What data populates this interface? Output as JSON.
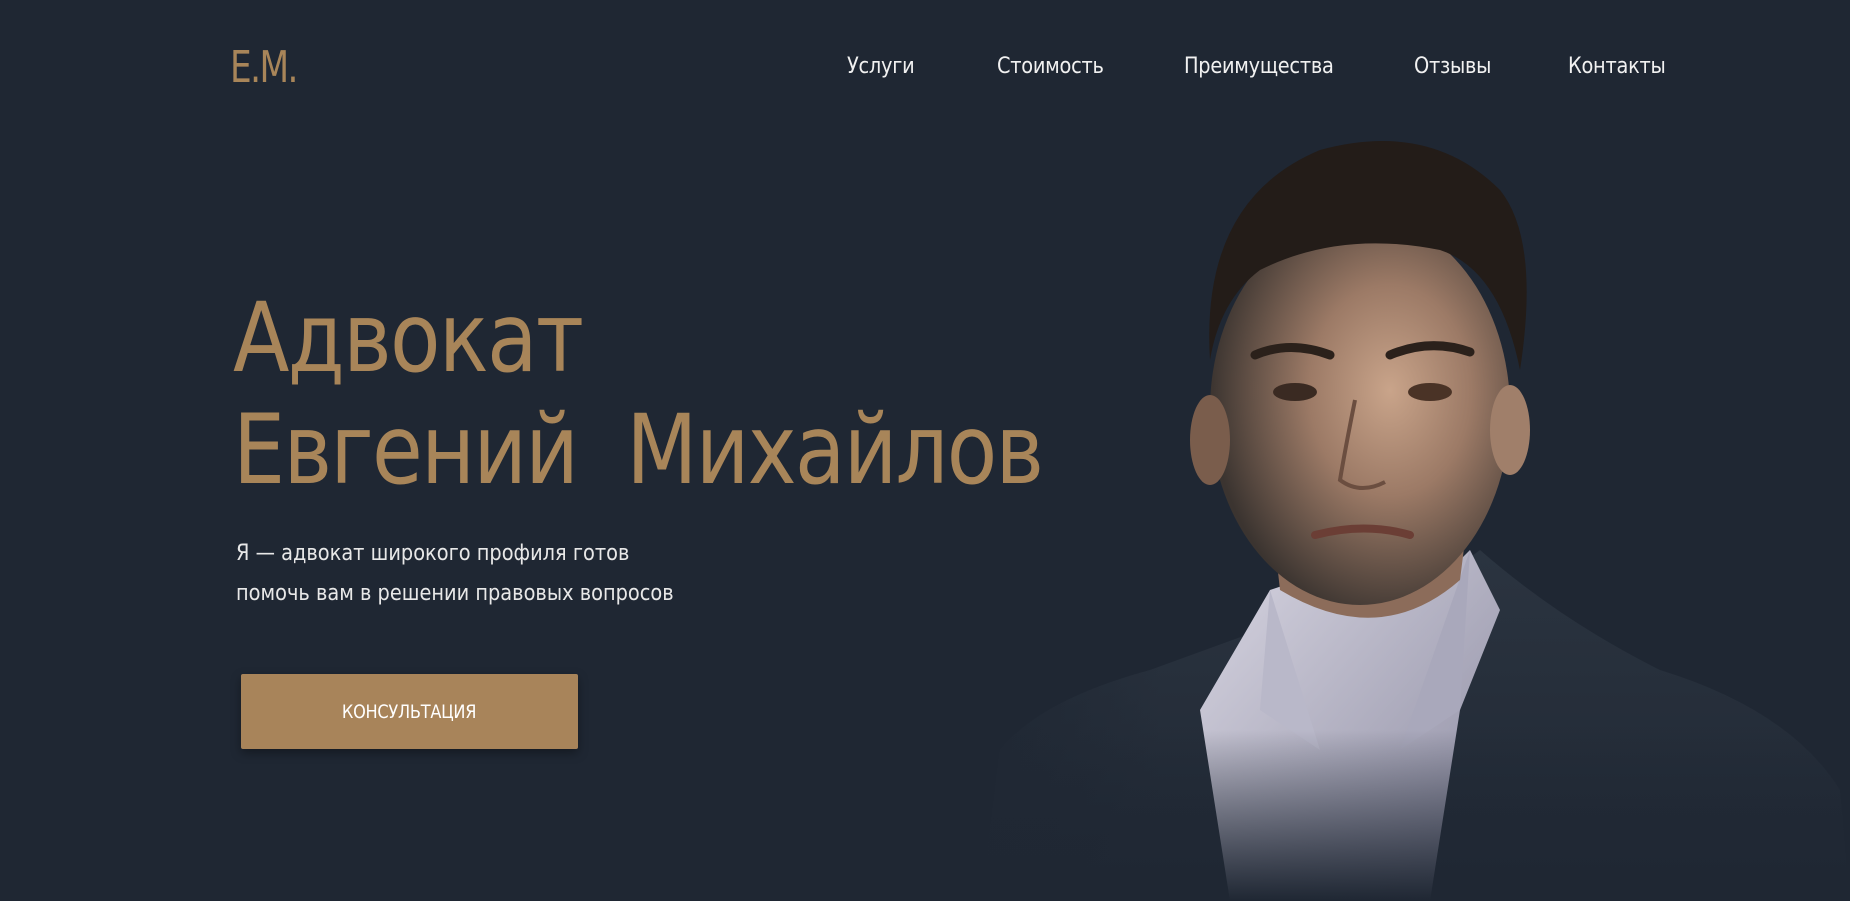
{
  "brand": {
    "logo": "E.M.",
    "accent_color": "#a88559",
    "background_color": "#1f2733"
  },
  "nav": {
    "items": [
      {
        "label": "Услуги"
      },
      {
        "label": "Стоимость"
      },
      {
        "label": "Преимущества"
      },
      {
        "label": "Отзывы"
      },
      {
        "label": "Контакты"
      }
    ]
  },
  "hero": {
    "title_line1": "Адвокат",
    "title_line2": "Евгений  Михайлов",
    "subtitle_line1": "Я — адвокат широкого профиля готов",
    "subtitle_line2": "помочь вам в решении правовых вопросов",
    "cta_label": "КОНСУЛЬТАЦИЯ",
    "portrait_icon": "lawyer-portrait-photo"
  }
}
